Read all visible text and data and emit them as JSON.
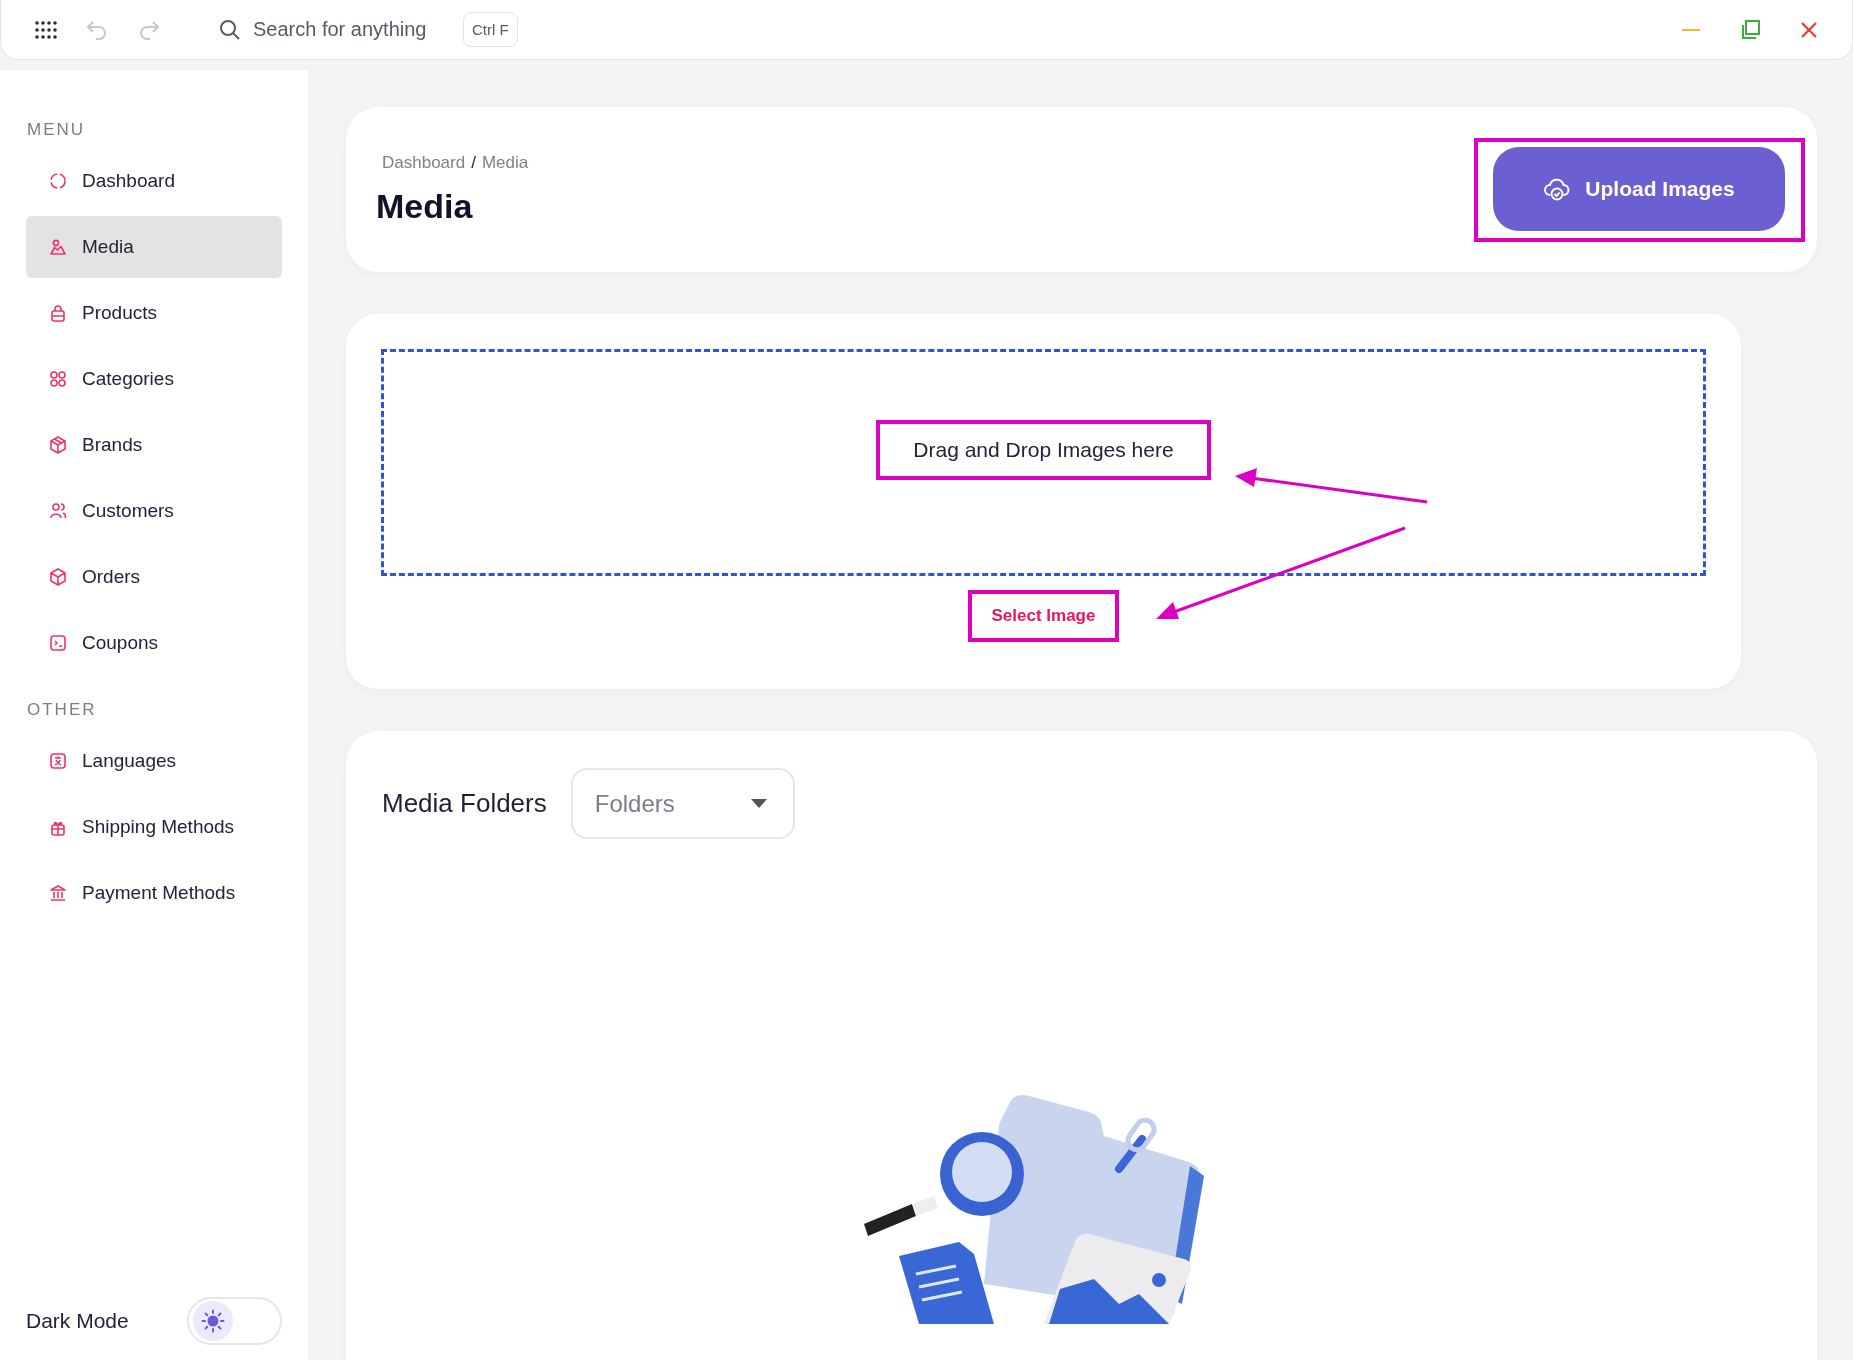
{
  "toolbar": {
    "search": {
      "placeholder": "Search for anything"
    },
    "shortcut": "Ctrl F"
  },
  "sidebar": {
    "sections": [
      {
        "title": "MENU",
        "items": [
          {
            "label": "Dashboard",
            "selected": false
          },
          {
            "label": "Media",
            "selected": true
          },
          {
            "label": "Products",
            "selected": false
          },
          {
            "label": "Categories",
            "selected": false
          },
          {
            "label": "Brands",
            "selected": false
          },
          {
            "label": "Customers",
            "selected": false
          },
          {
            "label": "Orders",
            "selected": false
          },
          {
            "label": "Coupons",
            "selected": false
          }
        ]
      },
      {
        "title": "OTHER",
        "items": [
          {
            "label": "Languages",
            "selected": false
          },
          {
            "label": "Shipping Methods",
            "selected": false
          },
          {
            "label": "Payment Methods",
            "selected": false
          }
        ]
      }
    ],
    "dark_mode": {
      "label": "Dark Mode",
      "on": false
    }
  },
  "header": {
    "breadcrumb": [
      "Dashboard",
      "Media"
    ],
    "separator": "/",
    "title": "Media",
    "upload_button": {
      "label": "Upload Images",
      "highlighted": true
    }
  },
  "dropzone": {
    "prompt": {
      "text": "Drag and Drop Images here",
      "highlighted": true
    },
    "select_button": {
      "label": "Select Image",
      "highlighted": true
    },
    "arrows": true
  },
  "media_folders": {
    "title": "Media Folders",
    "dropdown": {
      "value": "Folders"
    }
  }
}
